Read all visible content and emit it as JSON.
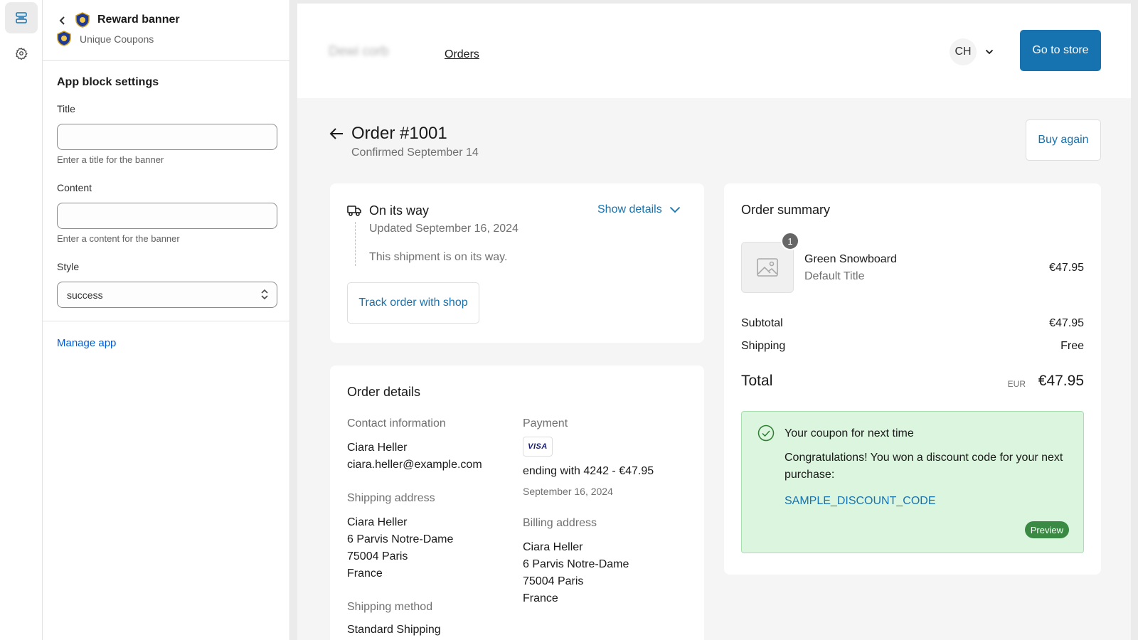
{
  "panel": {
    "header_title": "Reward banner",
    "header_subtitle": "Unique Coupons",
    "section_title": "App block settings",
    "title_field": {
      "label": "Title",
      "value": "",
      "help": "Enter a title for the banner"
    },
    "content_field": {
      "label": "Content",
      "value": "",
      "help": "Enter a content for the banner"
    },
    "style_field": {
      "label": "Style",
      "value": "success"
    },
    "manage_link": "Manage app"
  },
  "store": {
    "name": "Dewi corb",
    "nav_orders": "Orders",
    "account_initials": "CH",
    "go_to_store": "Go to store"
  },
  "order": {
    "title": "Order #1001",
    "confirmed": "Confirmed September 14",
    "buy_again": "Buy again",
    "tracking": {
      "status": "On its way",
      "show_details": "Show details",
      "updated": "Updated September 16, 2024",
      "message": "This shipment is on its way.",
      "track_button": "Track order with shop"
    },
    "details": {
      "title": "Order details",
      "contact_heading": "Contact information",
      "contact_name": "Ciara Heller",
      "contact_email": "ciara.heller@example.com",
      "payment_heading": "Payment",
      "card_brand": "VISA",
      "payment_line": "ending with 4242 - €47.95",
      "payment_date": "September 16, 2024",
      "shipping_heading": "Shipping address",
      "shipping_address": [
        "Ciara Heller",
        "6 Parvis Notre-Dame",
        "75004 Paris",
        "France"
      ],
      "billing_heading": "Billing address",
      "billing_address": [
        "Ciara Heller",
        "6 Parvis Notre-Dame",
        "75004 Paris",
        "France"
      ],
      "method_heading": "Shipping method",
      "method_value": "Standard Shipping"
    },
    "summary": {
      "title": "Order summary",
      "item": {
        "quantity": "1",
        "name": "Green Snowboard",
        "variant": "Default Title",
        "price": "€47.95"
      },
      "subtotal_label": "Subtotal",
      "subtotal_value": "€47.95",
      "shipping_label": "Shipping",
      "shipping_value": "Free",
      "total_label": "Total",
      "currency": "EUR",
      "total_value": "€47.95"
    },
    "coupon": {
      "title": "Your coupon for next time",
      "body": "Congratulations! You won a discount code for your next purchase:",
      "code": "SAMPLE_DISCOUNT_CODE",
      "badge": "Preview"
    }
  },
  "icons": [
    "sections-icon",
    "gear-icon",
    "chevron-left-icon",
    "badge-logo-icon",
    "select-arrows-icon",
    "chevron-down-icon",
    "arrow-left-icon",
    "truck-icon",
    "image-placeholder-icon",
    "check-circle-icon"
  ],
  "colors": {
    "brand_button": "#1773b0",
    "admin_link": "#005bd3",
    "coupon_bg": "#dcf5de",
    "preview_badge": "#3a8a44"
  }
}
